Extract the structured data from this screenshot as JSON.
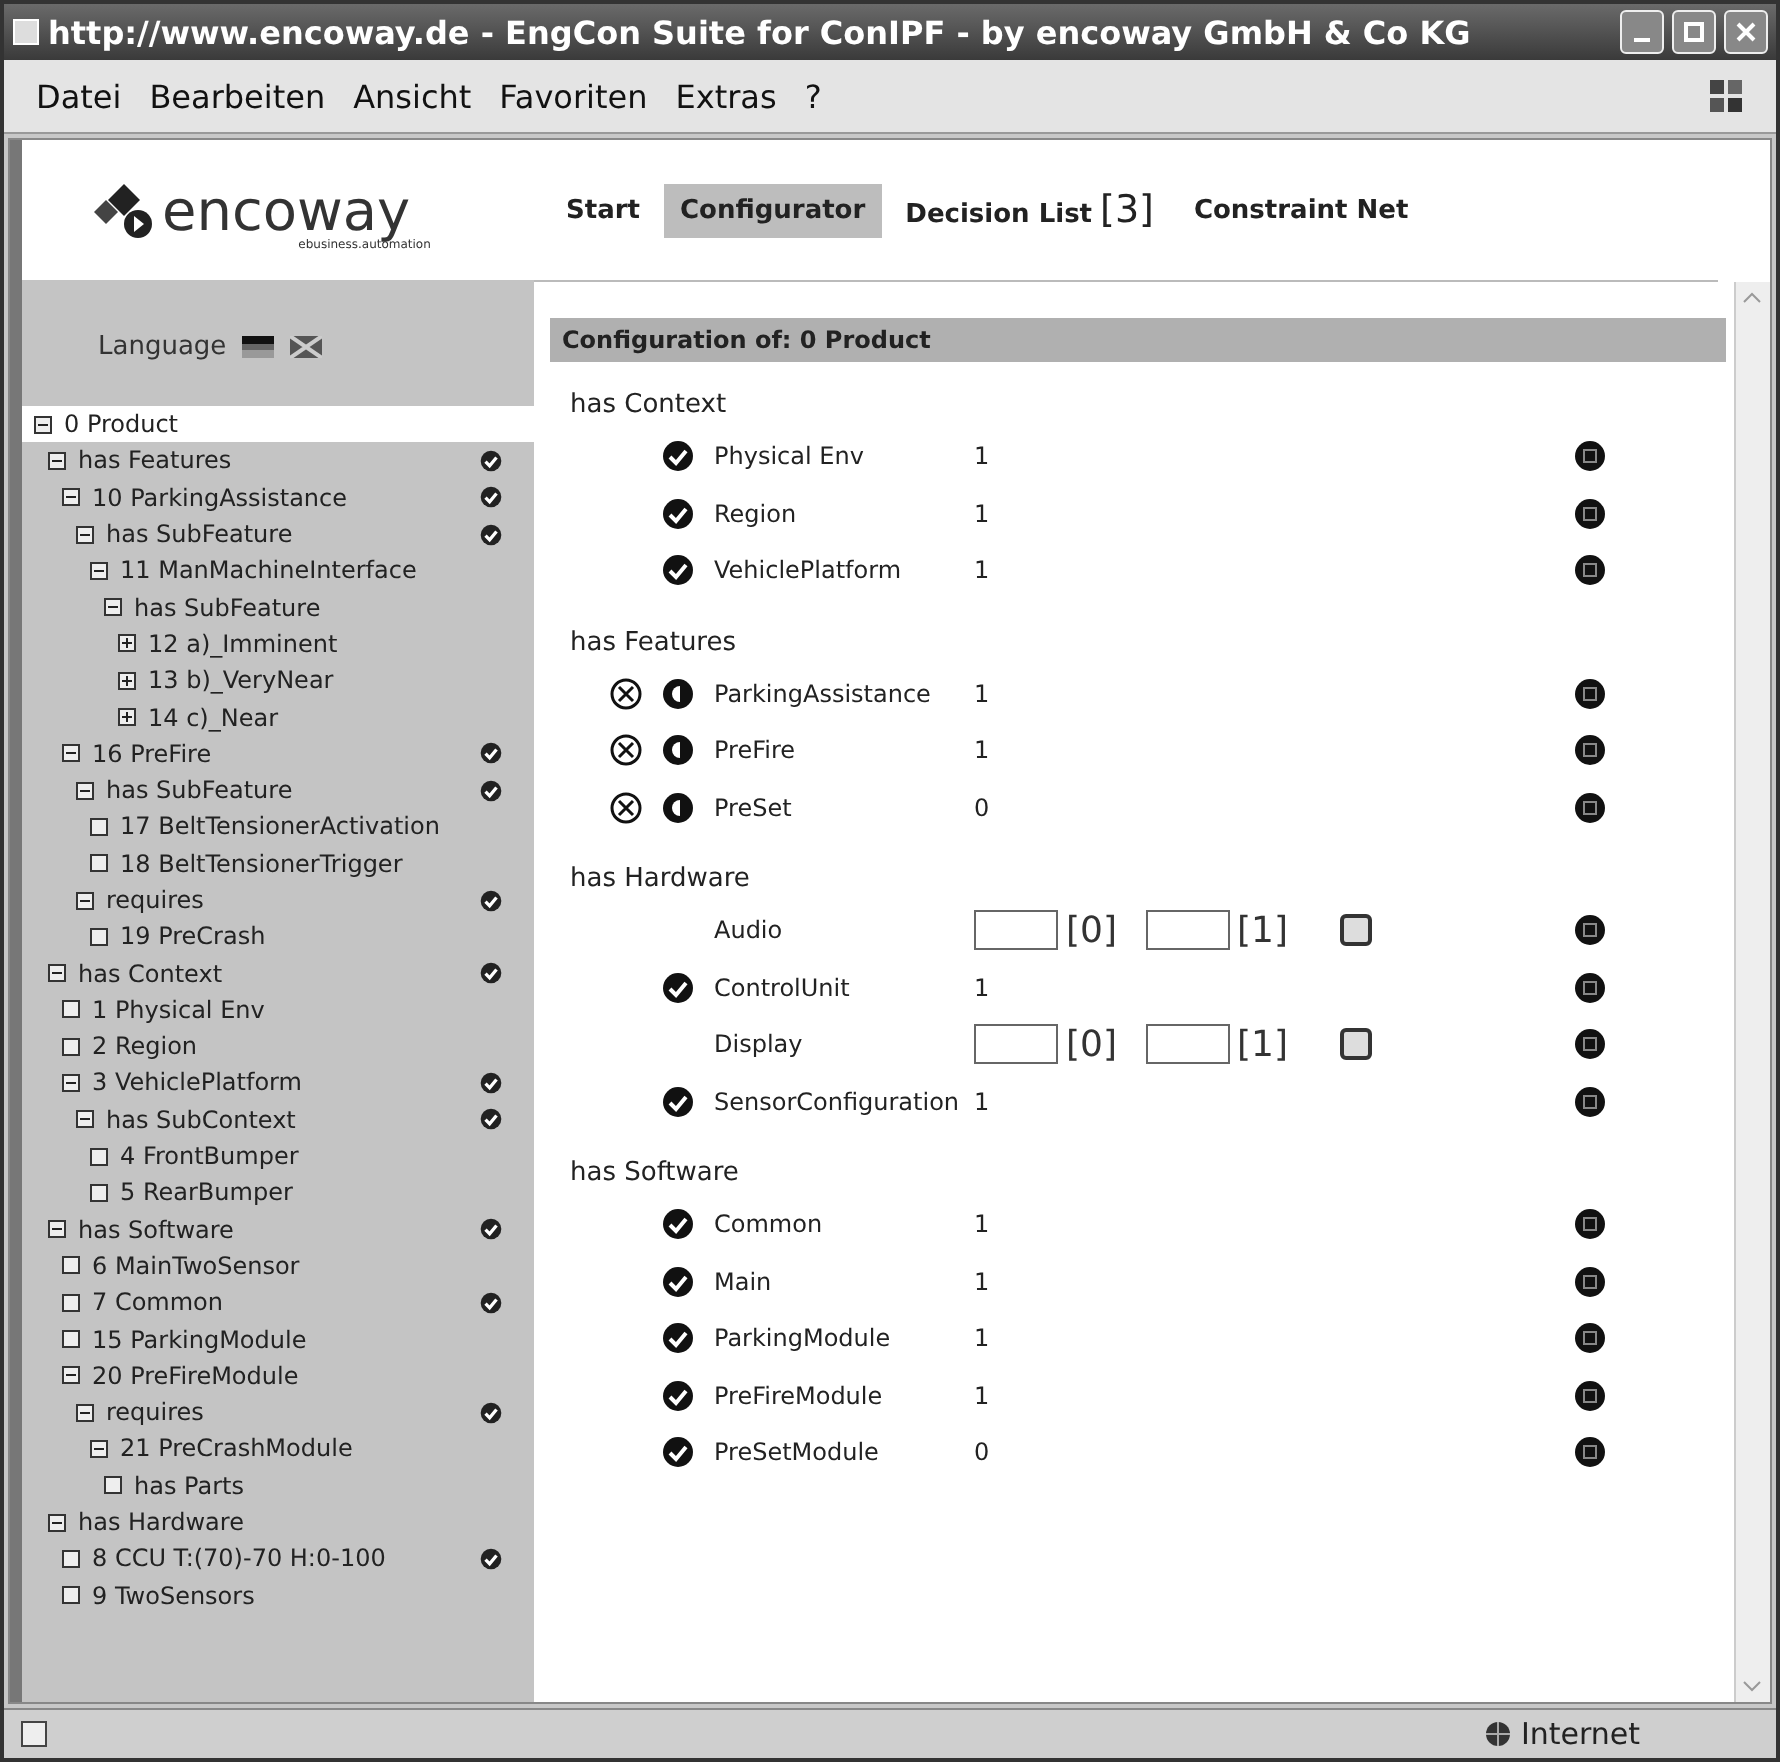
{
  "window": {
    "title": "http://www.encoway.de - EngCon Suite for ConIPF - by encoway GmbH & Co KG"
  },
  "menu": [
    "Datei",
    "Bearbeiten",
    "Ansicht",
    "Favoriten",
    "Extras",
    "?"
  ],
  "logo": {
    "name": "encoway",
    "tagline": "ebusiness.automation"
  },
  "tabs": [
    {
      "label": "Start",
      "selected": false
    },
    {
      "label": "Configurator",
      "selected": true
    },
    {
      "label": "Decision List",
      "count": "[3]",
      "selected": false
    },
    {
      "label": "Constraint Net",
      "selected": false
    }
  ],
  "sidebar": {
    "language_label": "Language",
    "tree": [
      {
        "label": "0 Product",
        "kind": "node",
        "expanded": true,
        "checked": false,
        "selected": true,
        "children": [
          {
            "label": "has Features",
            "kind": "node",
            "expanded": true,
            "checked": true,
            "selected": false,
            "children": [
              {
                "label": "10 ParkingAssistance",
                "kind": "node",
                "expanded": true,
                "checked": true,
                "selected": false,
                "children": [
                  {
                    "label": "has SubFeature",
                    "kind": "node",
                    "expanded": true,
                    "checked": true,
                    "selected": false,
                    "children": [
                      {
                        "label": "11 ManMachineInterface",
                        "kind": "node",
                        "expanded": true,
                        "checked": false,
                        "selected": false,
                        "children": [
                          {
                            "label": "has SubFeature",
                            "kind": "node",
                            "expanded": true,
                            "checked": false,
                            "selected": false,
                            "children": [
                              {
                                "label": "12 a)_Imminent",
                                "kind": "node",
                                "expanded": false,
                                "checked": false,
                                "selected": false
                              },
                              {
                                "label": "13 b)_VeryNear",
                                "kind": "node",
                                "expanded": false,
                                "checked": false,
                                "selected": false
                              },
                              {
                                "label": "14 c)_Near",
                                "kind": "node",
                                "expanded": false,
                                "checked": false,
                                "selected": false
                              }
                            ]
                          }
                        ]
                      }
                    ]
                  }
                ]
              },
              {
                "label": "16 PreFire",
                "kind": "node",
                "expanded": true,
                "checked": true,
                "selected": false,
                "children": [
                  {
                    "label": "has SubFeature",
                    "kind": "node",
                    "expanded": true,
                    "checked": true,
                    "selected": false,
                    "children": [
                      {
                        "label": "17 BeltTensionerActivation",
                        "kind": "leaf",
                        "checked": false,
                        "selected": false
                      },
                      {
                        "label": "18 BeltTensionerTrigger",
                        "kind": "leaf",
                        "checked": false,
                        "selected": false
                      }
                    ]
                  },
                  {
                    "label": "requires",
                    "kind": "node",
                    "expanded": true,
                    "checked": true,
                    "selected": false,
                    "children": [
                      {
                        "label": "19 PreCrash",
                        "kind": "leaf",
                        "checked": false,
                        "selected": false
                      }
                    ]
                  }
                ]
              }
            ]
          },
          {
            "label": "has Context",
            "kind": "node",
            "expanded": true,
            "checked": true,
            "selected": false,
            "children": [
              {
                "label": "1 Physical Env",
                "kind": "leaf",
                "checked": false,
                "selected": false
              },
              {
                "label": "2 Region",
                "kind": "leaf",
                "checked": false,
                "selected": false
              },
              {
                "label": "3 VehiclePlatform",
                "kind": "node",
                "expanded": true,
                "checked": true,
                "selected": false,
                "children": [
                  {
                    "label": "has SubContext",
                    "kind": "node",
                    "expanded": true,
                    "checked": true,
                    "selected": false,
                    "children": [
                      {
                        "label": "4 FrontBumper",
                        "kind": "leaf",
                        "checked": false,
                        "selected": false
                      },
                      {
                        "label": "5 RearBumper",
                        "kind": "leaf",
                        "checked": false,
                        "selected": false
                      }
                    ]
                  }
                ]
              }
            ]
          },
          {
            "label": "has Software",
            "kind": "node",
            "expanded": true,
            "checked": true,
            "selected": false,
            "children": [
              {
                "label": "6 MainTwoSensor",
                "kind": "leaf",
                "checked": false,
                "selected": false
              },
              {
                "label": "7 Common",
                "kind": "leaf",
                "checked": true,
                "selected": false
              },
              {
                "label": "15 ParkingModule",
                "kind": "leaf",
                "checked": false,
                "selected": false
              },
              {
                "label": "20 PreFireModule",
                "kind": "node",
                "expanded": true,
                "checked": false,
                "selected": false,
                "children": [
                  {
                    "label": "requires",
                    "kind": "node",
                    "expanded": true,
                    "checked": true,
                    "selected": false,
                    "children": [
                      {
                        "label": "21 PreCrashModule",
                        "kind": "node",
                        "expanded": true,
                        "checked": false,
                        "selected": false,
                        "children": [
                          {
                            "label": "has Parts",
                            "kind": "leaf",
                            "checked": false,
                            "selected": false
                          }
                        ]
                      }
                    ]
                  }
                ]
              }
            ]
          },
          {
            "label": "has Hardware",
            "kind": "node",
            "expanded": true,
            "checked": false,
            "selected": false,
            "children": [
              {
                "label": "8 CCU T:(70)-70 H:0-100",
                "kind": "leaf",
                "checked": true,
                "selected": false
              },
              {
                "label": "9 TwoSensors",
                "kind": "leaf",
                "checked": false,
                "selected": false
              }
            ]
          }
        ]
      }
    ]
  },
  "panel": {
    "title": "Configuration of: 0 Product",
    "sections": [
      {
        "title": "has Context",
        "rows": [
          {
            "kind": "value",
            "confirmed": true,
            "partial": false,
            "name": "Physical Env",
            "value": "1"
          },
          {
            "kind": "value",
            "confirmed": true,
            "partial": false,
            "name": "Region",
            "value": "1"
          },
          {
            "kind": "value",
            "confirmed": true,
            "partial": false,
            "name": "VehiclePlatform",
            "value": "1"
          }
        ]
      },
      {
        "title": "has Features",
        "rows": [
          {
            "kind": "value",
            "confirmed": false,
            "partial": true,
            "name": "ParkingAssistance",
            "value": "1"
          },
          {
            "kind": "value",
            "confirmed": false,
            "partial": true,
            "name": "PreFire",
            "value": "1"
          },
          {
            "kind": "value",
            "confirmed": false,
            "partial": true,
            "name": "PreSet",
            "value": "0"
          }
        ]
      },
      {
        "title": "has Hardware",
        "rows": [
          {
            "kind": "range",
            "confirmed": false,
            "partial": false,
            "name": "Audio",
            "min": "[0]",
            "max": "[1]"
          },
          {
            "kind": "value",
            "confirmed": true,
            "partial": false,
            "name": "ControlUnit",
            "value": "1"
          },
          {
            "kind": "range",
            "confirmed": false,
            "partial": false,
            "name": "Display",
            "min": "[0]",
            "max": "[1]"
          },
          {
            "kind": "value",
            "confirmed": true,
            "partial": false,
            "name": "SensorConfiguration",
            "value": "1"
          }
        ]
      },
      {
        "title": "has Software",
        "rows": [
          {
            "kind": "value",
            "confirmed": true,
            "partial": false,
            "name": "Common",
            "value": "1"
          },
          {
            "kind": "value",
            "confirmed": true,
            "partial": false,
            "name": "Main",
            "value": "1"
          },
          {
            "kind": "value",
            "confirmed": true,
            "partial": false,
            "name": "ParkingModule",
            "value": "1"
          },
          {
            "kind": "value",
            "confirmed": true,
            "partial": false,
            "name": "PreFireModule",
            "value": "1"
          },
          {
            "kind": "value",
            "confirmed": true,
            "partial": false,
            "name": "PreSetModule",
            "value": "0"
          }
        ]
      }
    ]
  },
  "status_bar": {
    "zone": "Internet"
  }
}
